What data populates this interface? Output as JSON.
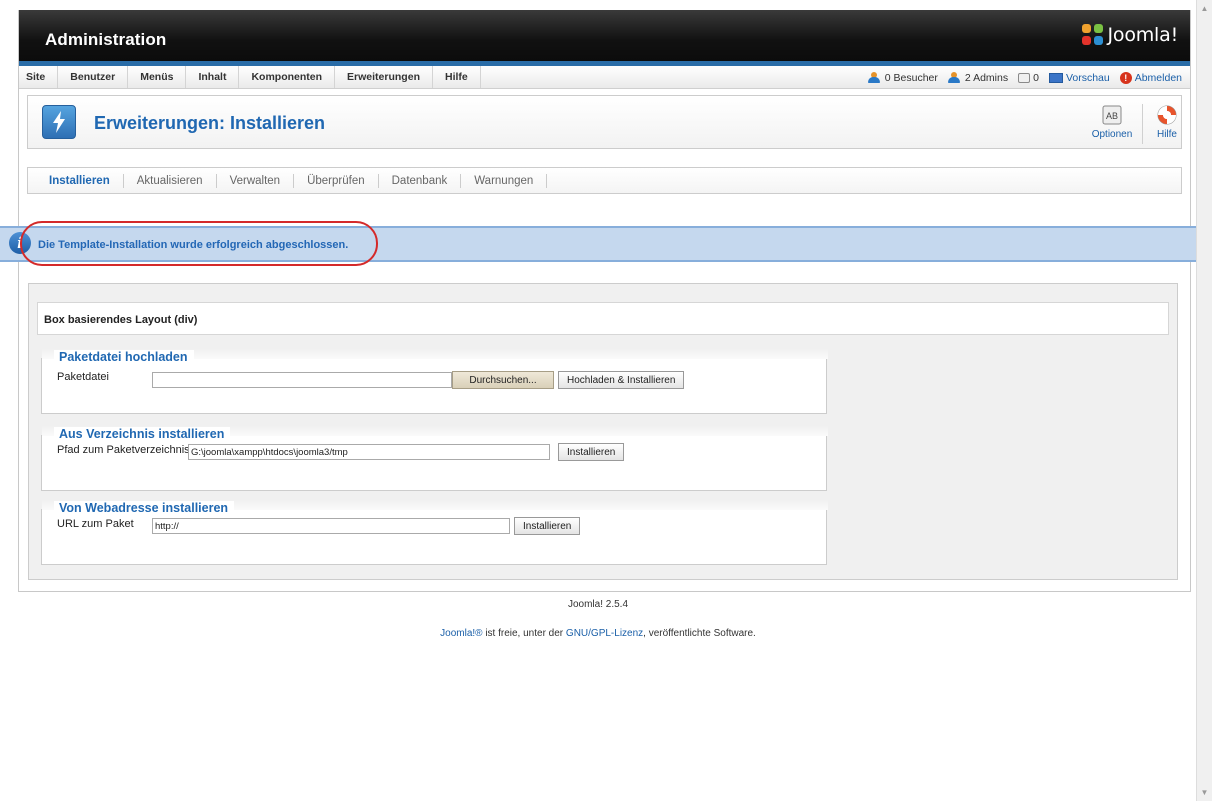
{
  "header": {
    "title": "Administration",
    "brand_word": "Joomla!",
    "colors": {
      "bar_dark": "#111111",
      "accent_blue": "#2a6da8"
    }
  },
  "menu": {
    "items": [
      {
        "label": "Site"
      },
      {
        "label": "Benutzer"
      },
      {
        "label": "Menüs"
      },
      {
        "label": "Inhalt"
      },
      {
        "label": "Komponenten"
      },
      {
        "label": "Erweiterungen"
      },
      {
        "label": "Hilfe"
      }
    ]
  },
  "status": {
    "visitors": "0 Besucher",
    "admins": "2 Admins",
    "messages": "0",
    "preview": "Vorschau",
    "logout": "Abmelden"
  },
  "toolbar": {
    "title": "Erweiterungen: Installieren",
    "options_label": "Optionen",
    "help_label": "Hilfe"
  },
  "subnav": {
    "tabs": [
      {
        "label": "Installieren",
        "active": true
      },
      {
        "label": "Aktualisieren",
        "active": false
      },
      {
        "label": "Verwalten",
        "active": false
      },
      {
        "label": "Überprüfen",
        "active": false
      },
      {
        "label": "Datenbank",
        "active": false
      },
      {
        "label": "Warnungen",
        "active": false
      }
    ]
  },
  "message": {
    "text": "Die Template-Installation wurde erfolgreich abgeschlossen.",
    "colors": {
      "background": "#c5d8ee",
      "text": "#2367b5",
      "highlight_ring": "#d42a2a"
    }
  },
  "layout_box": {
    "label": "Box basierendes Layout (div)"
  },
  "upload": {
    "legend": "Paketdatei hochladen",
    "field_label": "Paketdatei",
    "field_value": "",
    "browse_label": "Durchsuchen...",
    "submit_label": "Hochladen & Installieren"
  },
  "directory": {
    "legend": "Aus Verzeichnis installieren",
    "field_label": "Pfad zum Paketverzeichnis",
    "field_value": "G:\\joomla\\xampp\\htdocs\\joomla3/tmp",
    "submit_label": "Installieren"
  },
  "url": {
    "legend": "Von Webadresse installieren",
    "field_label": "URL zum Paket",
    "field_value": "http://",
    "submit_label": "Installieren"
  },
  "footer": {
    "version": "Joomla! 2.5.4",
    "license_link1": "Joomla!®",
    "license_mid": " ist freie, unter der ",
    "license_link2": "GNU/GPL-Lizenz",
    "license_end": ", veröffentlichte Software."
  }
}
